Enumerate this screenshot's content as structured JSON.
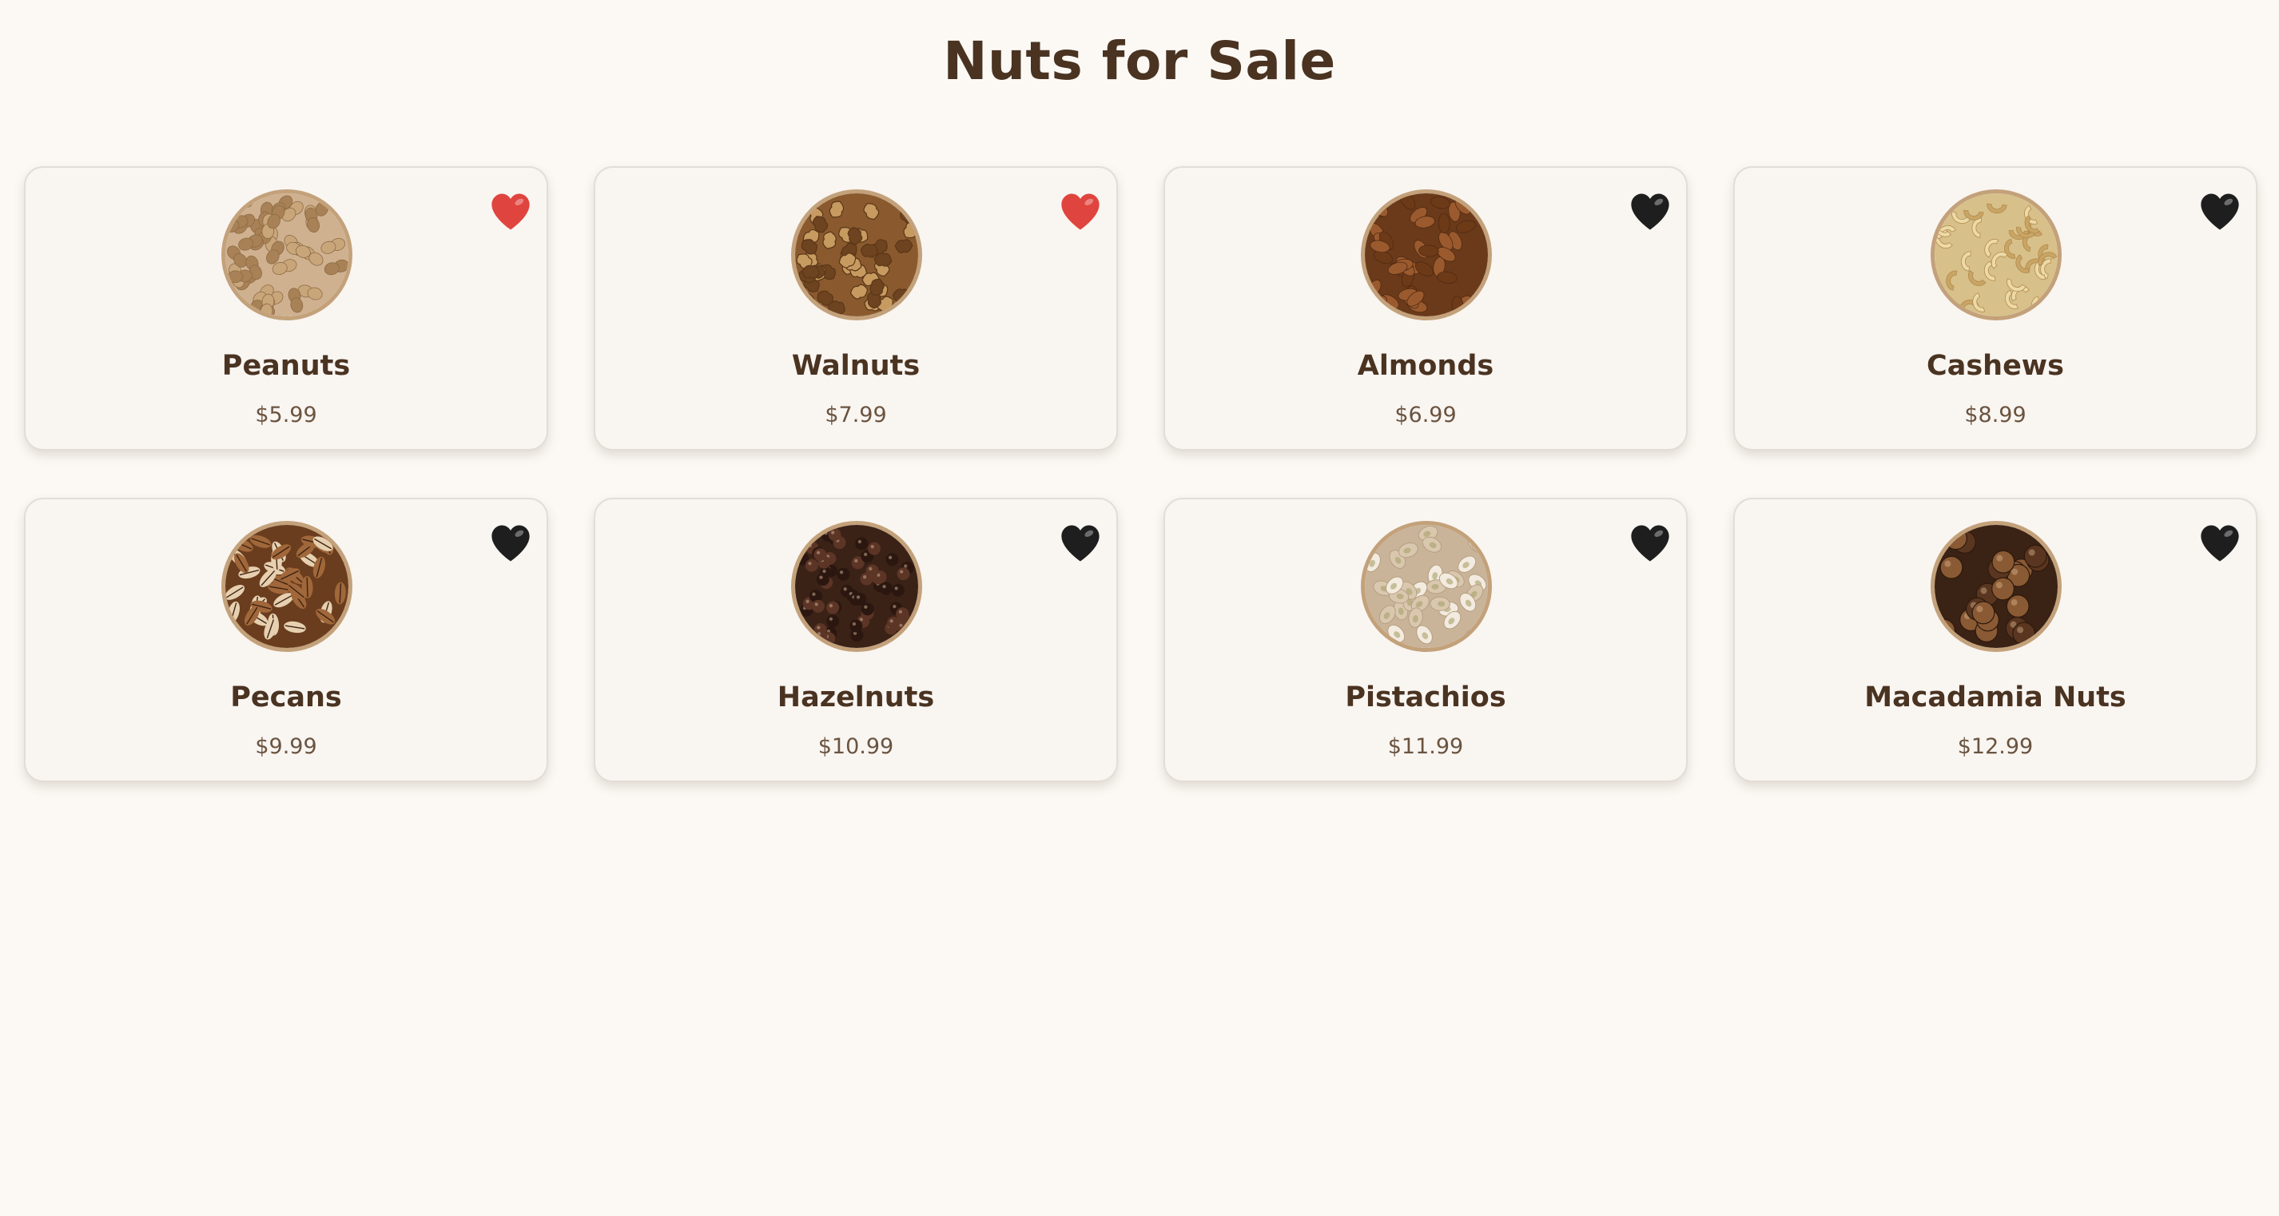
{
  "page": {
    "title": "Nuts for Sale"
  },
  "colors": {
    "background": "#fcf9f5",
    "card": "#f9f5f1",
    "text": "#4a3321",
    "favorite_on": "#e0443e",
    "favorite_off": "#1e1e1e",
    "image_ring": "#c3a17a"
  },
  "products": [
    {
      "name": "Peanuts",
      "price": "$5.99",
      "favorite": true,
      "image": "peanuts-image",
      "icon": "heart-icon"
    },
    {
      "name": "Walnuts",
      "price": "$7.99",
      "favorite": true,
      "image": "walnuts-image",
      "icon": "heart-icon"
    },
    {
      "name": "Almonds",
      "price": "$6.99",
      "favorite": false,
      "image": "almonds-image",
      "icon": "heart-icon"
    },
    {
      "name": "Cashews",
      "price": "$8.99",
      "favorite": false,
      "image": "cashews-image",
      "icon": "heart-icon"
    },
    {
      "name": "Pecans",
      "price": "$9.99",
      "favorite": false,
      "image": "pecans-image",
      "icon": "heart-icon"
    },
    {
      "name": "Hazelnuts",
      "price": "$10.99",
      "favorite": false,
      "image": "hazelnuts-image",
      "icon": "heart-icon"
    },
    {
      "name": "Pistachios",
      "price": "$11.99",
      "favorite": false,
      "image": "pistachios-image",
      "icon": "heart-icon"
    },
    {
      "name": "Macadamia Nuts",
      "price": "$12.99",
      "favorite": false,
      "image": "macadamia-image",
      "icon": "heart-icon"
    }
  ]
}
